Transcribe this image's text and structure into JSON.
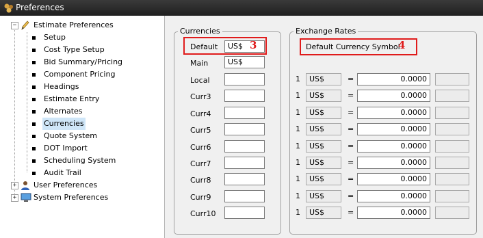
{
  "window": {
    "title": "Preferences"
  },
  "tree": {
    "estimate": {
      "label": "Estimate Preferences",
      "children": [
        "Setup",
        "Cost Type Setup",
        "Bid Summary/Pricing",
        "Component Pricing",
        "Headings",
        "Estimate Entry",
        "Alternates",
        "Currencies",
        "Quote System",
        "DOT Import",
        "Scheduling System",
        "Audit Trail"
      ],
      "selected": "Currencies"
    },
    "user": {
      "label": "User Preferences"
    },
    "system": {
      "label": "System Preferences"
    }
  },
  "currencies": {
    "title": "Currencies",
    "default": {
      "label": "Default",
      "value": "US$"
    },
    "main": {
      "label": "Main",
      "value": "US$"
    },
    "rows": [
      {
        "label": "Local",
        "value": ""
      },
      {
        "label": "Curr3",
        "value": ""
      },
      {
        "label": "Curr4",
        "value": ""
      },
      {
        "label": "Curr5",
        "value": ""
      },
      {
        "label": "Curr6",
        "value": ""
      },
      {
        "label": "Curr7",
        "value": ""
      },
      {
        "label": "Curr8",
        "value": ""
      },
      {
        "label": "Curr9",
        "value": ""
      },
      {
        "label": "Curr10",
        "value": ""
      }
    ]
  },
  "exchange": {
    "title": "Exchange Rates",
    "default_symbol_label": "Default Currency Symbol",
    "rows": [
      {
        "qty": "1",
        "symbol": "US$",
        "eq": "=",
        "rate": "0.0000",
        "code": ""
      },
      {
        "qty": "1",
        "symbol": "US$",
        "eq": "=",
        "rate": "0.0000",
        "code": ""
      },
      {
        "qty": "1",
        "symbol": "US$",
        "eq": "=",
        "rate": "0.0000",
        "code": ""
      },
      {
        "qty": "1",
        "symbol": "US$",
        "eq": "=",
        "rate": "0.0000",
        "code": ""
      },
      {
        "qty": "1",
        "symbol": "US$",
        "eq": "=",
        "rate": "0.0000",
        "code": ""
      },
      {
        "qty": "1",
        "symbol": "US$",
        "eq": "=",
        "rate": "0.0000",
        "code": ""
      },
      {
        "qty": "1",
        "symbol": "US$",
        "eq": "=",
        "rate": "0.0000",
        "code": ""
      },
      {
        "qty": "1",
        "symbol": "US$",
        "eq": "=",
        "rate": "0.0000",
        "code": ""
      },
      {
        "qty": "1",
        "symbol": "US$",
        "eq": "=",
        "rate": "0.0000",
        "code": ""
      }
    ]
  },
  "callouts": {
    "default_field": "3",
    "default_symbol": "4"
  },
  "colors": {
    "highlight": "#e01b1b",
    "selection": "#cfe6f8",
    "titlebar": "#2a2a2a"
  }
}
